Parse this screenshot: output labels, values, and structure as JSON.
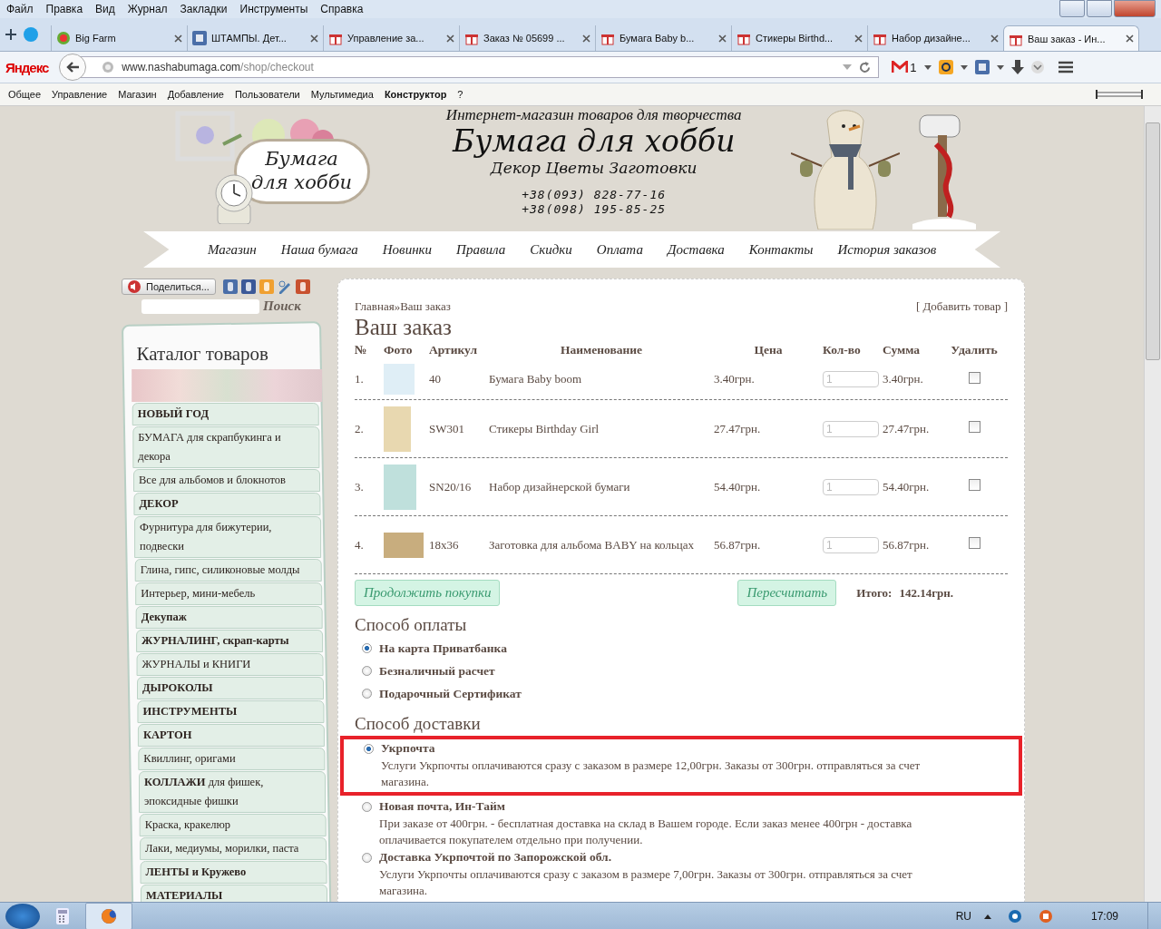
{
  "browser": {
    "menu": [
      "Файл",
      "Правка",
      "Вид",
      "Журнал",
      "Закладки",
      "Инструменты",
      "Справка"
    ],
    "tabs": [
      {
        "label": "Big Farm",
        "kind": "game",
        "selected": false
      },
      {
        "label": "ШТАМПЫ. Дет...",
        "kind": "social",
        "selected": false
      },
      {
        "label": "Управление за...",
        "kind": "shop",
        "selected": false
      },
      {
        "label": "Заказ № 05699 ...",
        "kind": "shop",
        "selected": false
      },
      {
        "label": "Бумага Baby b...",
        "kind": "shop",
        "selected": false
      },
      {
        "label": "Стикеры Birthd...",
        "kind": "shop",
        "selected": false
      },
      {
        "label": "Набор дизайне...",
        "kind": "shop",
        "selected": false
      },
      {
        "label": "Ваш заказ - Ин...",
        "kind": "shop",
        "selected": true
      }
    ],
    "search_brand": "Яндекс",
    "address": {
      "host": "www.nashabumaga.com",
      "path": "/shop/checkout"
    },
    "mail_count": "1",
    "admin_bar": [
      {
        "label": "Общее",
        "bold": false
      },
      {
        "label": "Управление",
        "bold": false
      },
      {
        "label": "Магазин",
        "bold": false
      },
      {
        "label": "Добавление",
        "bold": false
      },
      {
        "label": "Пользователи",
        "bold": false
      },
      {
        "label": "Мультимедиа",
        "bold": false
      },
      {
        "label": "Конструктор",
        "bold": true
      },
      {
        "label": "?",
        "bold": false
      }
    ]
  },
  "site_header": {
    "logo_text": "Бумага для хобби",
    "tagline": "Интернет-магазин товаров для творчества",
    "title": "Бумага для хобби",
    "subtitle": "Декор Цветы Заготовки",
    "phones": [
      "+38(093) 828-77-16",
      "+38(098) 195-85-25"
    ],
    "nav": [
      "Магазин",
      "Наша бумага",
      "Новинки",
      "Правила",
      "Скидки",
      "Оплата",
      "Доставка",
      "Контакты",
      "История заказов"
    ]
  },
  "share": {
    "button": "Поделиться...",
    "search_button": "Поиск"
  },
  "catalog": {
    "title": "Каталог товаров",
    "items": [
      {
        "label": "НОВЫЙ ГОД",
        "bold": true
      },
      {
        "label": "БУМАГА для скрапбукинга и декора",
        "bold": false
      },
      {
        "label": "Все для альбомов и блокнотов",
        "bold": false
      },
      {
        "label": "ДЕКОР",
        "bold": true
      },
      {
        "label": "Фурнитура для бижутерии, подвески",
        "bold": false
      },
      {
        "label": "Глина, гипс, силиконовые молды",
        "bold": false
      },
      {
        "label": "Интерьер, мини-мебель",
        "bold": false
      },
      {
        "label": "Декупаж",
        "bold": true
      },
      {
        "label": "ЖУРНАЛИНГ, скрап-карты",
        "bold": true
      },
      {
        "label": "ЖУРНАЛЫ и КНИГИ",
        "bold": false
      },
      {
        "label": "ДЫРОКОЛЫ",
        "bold": true
      },
      {
        "label": "ИНСТРУМЕНТЫ",
        "bold": true
      },
      {
        "label": "КАРТОН",
        "bold": true
      },
      {
        "label": "Квиллинг, оригами",
        "bold": false
      },
      {
        "label": "**КОЛЛАЖИ** для фишек, эпоксидные фишки",
        "bold": false
      },
      {
        "label": "Краска, кракелюр",
        "bold": false
      },
      {
        "label": "Лаки, медиумы, морилки, паста",
        "bold": false
      },
      {
        "label": "ЛЕНТЫ и Кружево",
        "bold": true
      },
      {
        "label": "МАТЕРИАЛЫ",
        "bold": true
      }
    ]
  },
  "order": {
    "breadcrumb": [
      "Главная",
      "Ваш заказ"
    ],
    "separator": "»",
    "add_link": "[ Добавить товар ]",
    "heading": "Ваш заказ",
    "columns": [
      "№",
      "Фото",
      "Артикул",
      "Наименование",
      "Цена",
      "Кол-во",
      "Сумма",
      "Удалить"
    ],
    "rows": [
      {
        "number": "1.",
        "article": "40",
        "name": "Бумага Baby boom",
        "price": "3.40грн.",
        "qty": "1",
        "sum": "3.40грн.",
        "checked": false
      },
      {
        "number": "2.",
        "article": "SW301",
        "name": "Стикеры Birthday Girl",
        "price": "27.47грн.",
        "qty": "1",
        "sum": "27.47грн.",
        "checked": false
      },
      {
        "number": "3.",
        "article": "SN20/16",
        "name": "Набор дизайнерской бумаги",
        "price": "54.40грн.",
        "qty": "1",
        "sum": "54.40грн.",
        "checked": false
      },
      {
        "number": "4.",
        "article": "18x36",
        "name": "Заготовка для альбома BABY на кольцах",
        "price": "56.87грн.",
        "qty": "1",
        "sum": "56.87грн.",
        "checked": false
      }
    ],
    "continue_button": "Продолжить покупки",
    "recalc_button": "Пересчитать",
    "total_label": "Итого:",
    "total": "142.14грн."
  },
  "payment": {
    "heading": "Способ оплаты",
    "options": [
      {
        "label": "На карта Приватбанка",
        "selected": true
      },
      {
        "label": "Безналичный расчет",
        "selected": false
      },
      {
        "label": "Подарочный Сертификат",
        "selected": false
      }
    ]
  },
  "delivery": {
    "heading": "Способ доставки",
    "options": [
      {
        "label": "Укрпочта",
        "description": "Услуги Укрпочты оплачиваются сразу с заказом в размере 12,00грн. Заказы от 300грн. отправляться за счет магазина.",
        "selected": true,
        "highlighted": true
      },
      {
        "label": "Новая почта, Ин-Тайм",
        "description": "При заказе от 400грн. - бесплатная доставка на склад в Вашем городе. Если заказ менее 400грн - доставка оплачивается покупателем отдельно при получении.",
        "selected": false,
        "highlighted": false
      },
      {
        "label": "Доставка Укрпочтой по Запорожской обл.",
        "description": "Услуги Укрпочты оплачиваются сразу с заказом в размере 7,00грн. Заказы от 300грн. отправляться за счет магазина.",
        "selected": false,
        "highlighted": false
      }
    ]
  },
  "taskbar": {
    "language": "RU",
    "clock": "17:09"
  }
}
